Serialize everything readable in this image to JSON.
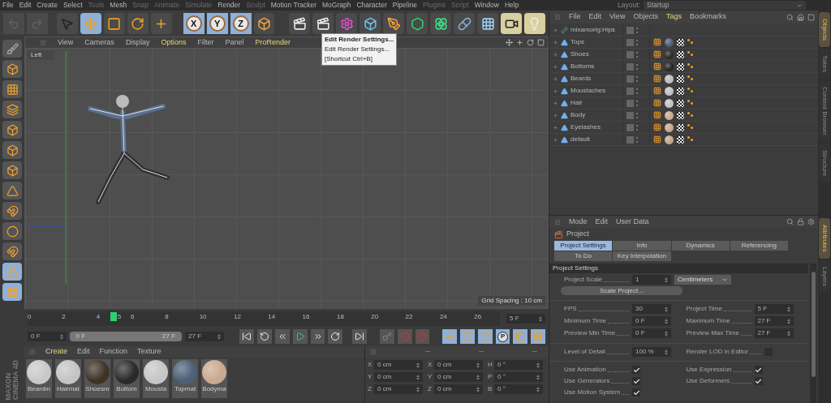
{
  "menu_bar": [
    {
      "label": "File",
      "disabled": false
    },
    {
      "label": "Edit",
      "disabled": false
    },
    {
      "label": "Create",
      "disabled": false
    },
    {
      "label": "Select",
      "disabled": false
    },
    {
      "label": "Tools",
      "disabled": true
    },
    {
      "label": "Mesh",
      "disabled": false
    },
    {
      "label": "Snap",
      "disabled": true
    },
    {
      "label": "Animate",
      "disabled": true
    },
    {
      "label": "Simulate",
      "disabled": true
    },
    {
      "label": "Render",
      "disabled": false
    },
    {
      "label": "Sculpt",
      "disabled": true
    },
    {
      "label": "Motion Tracker",
      "disabled": false
    },
    {
      "label": "MoGraph",
      "disabled": false
    },
    {
      "label": "Character",
      "disabled": false
    },
    {
      "label": "Pipeline",
      "disabled": false
    },
    {
      "label": "Plugins",
      "disabled": true
    },
    {
      "label": "Script",
      "disabled": true
    },
    {
      "label": "Window",
      "disabled": false
    },
    {
      "label": "Help",
      "disabled": false
    }
  ],
  "layout": {
    "label": "Layout:",
    "value": "Startup"
  },
  "tools": [
    {
      "selected": false
    },
    {
      "selected": true
    },
    {
      "selected": false
    },
    {
      "selected": false
    },
    {
      "selected": false
    }
  ],
  "axis_buttons": [
    {
      "label": "X",
      "selected": true
    },
    {
      "label": "Y",
      "selected": true
    },
    {
      "label": "Z",
      "selected": true
    }
  ],
  "tooltip": [
    "Edit Render Settings...",
    "Edit Render Settings...",
    "[Shortcut Ctrl+B]"
  ],
  "viewport": {
    "menu": [
      {
        "label": "View",
        "highlighted": false
      },
      {
        "label": "Cameras",
        "highlighted": false
      },
      {
        "label": "Display",
        "highlighted": false
      },
      {
        "label": "Options",
        "highlighted": true
      },
      {
        "label": "Filter",
        "highlighted": false
      },
      {
        "label": "Panel",
        "highlighted": false
      },
      {
        "label": "ProRender",
        "highlighted": true
      }
    ],
    "view_name": "Left",
    "grid_spacing": "Grid Spacing : 10 cm"
  },
  "timeline": {
    "ticks": [
      "0",
      "2",
      "4",
      "6",
      "8",
      "10",
      "12",
      "14",
      "16",
      "18",
      "20",
      "22",
      "24",
      "26"
    ],
    "playhead": "5",
    "level": 0.18,
    "current_frame": "5 F"
  },
  "transport": {
    "start": "0 F",
    "range_start": "0 F",
    "range_end": "27 F",
    "end": "27 F",
    "param_button": "P"
  },
  "material_manager": {
    "menu": [
      {
        "label": "Create",
        "highlighted": true
      },
      {
        "label": "Edit",
        "highlighted": false
      },
      {
        "label": "Function",
        "highlighted": false
      },
      {
        "label": "Texture",
        "highlighted": false
      }
    ],
    "materials": [
      {
        "name": "Beardm",
        "color": "#c8c8c8"
      },
      {
        "name": "Hairmat",
        "color": "#c4c4c4"
      },
      {
        "name": "Shoesm",
        "color": "#3e3326"
      },
      {
        "name": "Bottom",
        "color": "#2a2a2a"
      },
      {
        "name": "Mousta",
        "color": "#c6c6c6"
      },
      {
        "name": "Topmat",
        "color": "#4c6078"
      },
      {
        "name": "Bodyma",
        "color": "#c9a98f"
      }
    ]
  },
  "coordinates": {
    "headers": [
      "--",
      "--",
      "--"
    ],
    "rows": [
      [
        {
          "label": "X",
          "value": "0 cm"
        },
        {
          "label": "X",
          "value": "0 cm"
        },
        {
          "label": "H",
          "value": "0 °"
        }
      ],
      [
        {
          "label": "Y",
          "value": "0 cm"
        },
        {
          "label": "Y",
          "value": "0 cm"
        },
        {
          "label": "P",
          "value": "0 °"
        }
      ],
      [
        {
          "label": "Z",
          "value": "0 cm"
        },
        {
          "label": "Z",
          "value": "0 cm"
        },
        {
          "label": "B",
          "value": "0 °"
        }
      ]
    ]
  },
  "logo": [
    "MAXON",
    "CINEMA 4D"
  ],
  "object_manager": {
    "menu": [
      {
        "label": "File",
        "highlighted": false
      },
      {
        "label": "Edit",
        "highlighted": false
      },
      {
        "label": "View",
        "highlighted": false
      },
      {
        "label": "Objects",
        "highlighted": false
      },
      {
        "label": "Tags",
        "highlighted": true
      },
      {
        "label": "Bookmarks",
        "highlighted": false
      }
    ],
    "objects": [
      {
        "name": "mixamorig:Hips",
        "kind": "joint"
      },
      {
        "name": "Tops",
        "kind": "mesh",
        "color": "#4c6078"
      },
      {
        "name": "Shoes",
        "kind": "mesh",
        "color": "#2e2a24"
      },
      {
        "name": "Bottoms",
        "kind": "mesh",
        "color": "#262626"
      },
      {
        "name": "Beards",
        "kind": "mesh",
        "color": "#bcbcbc"
      },
      {
        "name": "Moustaches",
        "kind": "mesh",
        "color": "#bfbfbf"
      },
      {
        "name": "Hair",
        "kind": "mesh",
        "color": "#c2c2c2"
      },
      {
        "name": "Body",
        "kind": "mesh",
        "color": "#c9a98f"
      },
      {
        "name": "Eyelashes",
        "kind": "mesh",
        "color": "#c7a68c"
      },
      {
        "name": "default",
        "kind": "mesh",
        "color": "#c5a58b"
      }
    ]
  },
  "side_tabs_top": [
    {
      "label": "Objects",
      "selected": true
    },
    {
      "label": "Takes",
      "selected": false
    },
    {
      "label": "Content Browser",
      "selected": false
    },
    {
      "label": "Structure",
      "selected": false
    }
  ],
  "side_tabs_bottom": [
    {
      "label": "Attributes",
      "selected": true
    },
    {
      "label": "Layers",
      "selected": false
    }
  ],
  "attributes": {
    "menu": [
      "Mode",
      "Edit",
      "User Data"
    ],
    "title": "Project",
    "tabs": [
      {
        "label": "Project Settings",
        "selected": true
      },
      {
        "label": "Info",
        "selected": false
      },
      {
        "label": "Dynamics",
        "selected": false
      },
      {
        "label": "Referencing",
        "selected": false
      },
      {
        "label": "To Do",
        "selected": false
      },
      {
        "label": "Key Interpolation",
        "selected": false
      }
    ],
    "section": "Project Settings",
    "project_scale": {
      "label": "Project Scale",
      "value": "1",
      "unit": "Centimeters"
    },
    "scale_button": "Scale Project...",
    "fields": [
      {
        "label": "FPS",
        "value": "30"
      },
      {
        "label": "Project Time",
        "value": "5 F"
      },
      {
        "label": "Minimum Time",
        "value": "0 F"
      },
      {
        "label": "Maximum Time",
        "value": "27 F"
      },
      {
        "label": "Preview Min Time",
        "value": "0 F"
      },
      {
        "label": "Preview Max Time",
        "value": "27 F"
      }
    ],
    "level_of_detail": {
      "label": "Level of Detail",
      "value": "100 %"
    },
    "render_lod": {
      "label": "Render LOD in Editor",
      "checked": false
    },
    "checks": [
      {
        "label": "Use Animation",
        "checked": true
      },
      {
        "label": "Use Expression",
        "checked": true
      },
      {
        "label": "Use Generators",
        "checked": true
      },
      {
        "label": "Use Deformers",
        "checked": true
      },
      {
        "label": "Use Motion System",
        "checked": true
      }
    ]
  }
}
